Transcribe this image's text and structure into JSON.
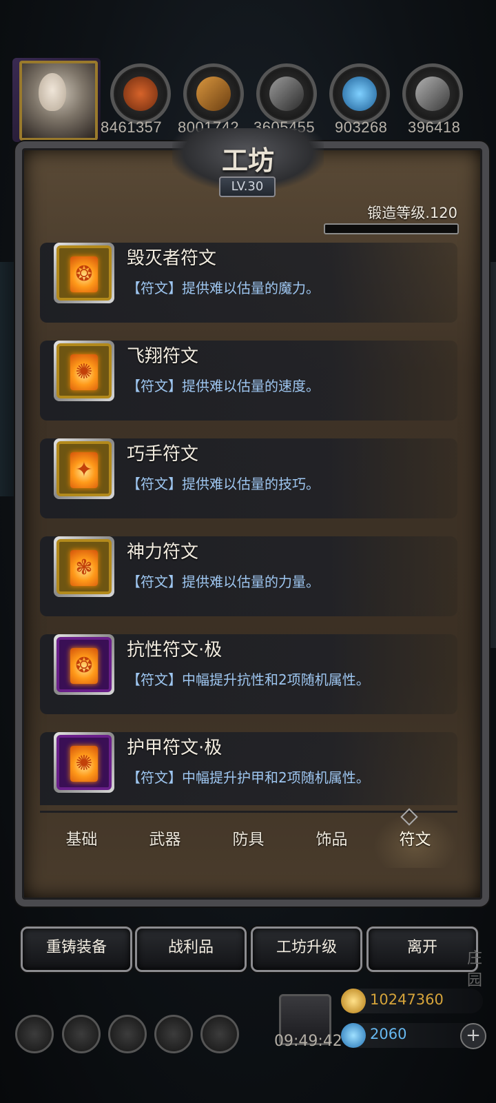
{
  "resources": [
    {
      "icon": "meat-icon",
      "value": "8461357",
      "color": "#a2481d"
    },
    {
      "icon": "wood-icon",
      "value": "8001742",
      "color": "#b9772d"
    },
    {
      "icon": "iron-icon",
      "value": "3605455",
      "color": "#5a5a5a"
    },
    {
      "icon": "crystal-icon",
      "value": "903268",
      "color": "#2e8fd8"
    },
    {
      "icon": "ingot-icon",
      "value": "396418",
      "color": "#7a7a7a"
    }
  ],
  "panel": {
    "title": "工坊",
    "level": "LV.30",
    "forge_level": "锻造等级.120",
    "forge_progress": 0
  },
  "runes": [
    {
      "name": "毁灭者符文",
      "desc": "【符文】提供难以估量的魔力。",
      "rarity": "gold",
      "glyph": "❂"
    },
    {
      "name": "飞翔符文",
      "desc": "【符文】提供难以估量的速度。",
      "rarity": "gold",
      "glyph": "✺"
    },
    {
      "name": "巧手符文",
      "desc": "【符文】提供难以估量的技巧。",
      "rarity": "gold",
      "glyph": "✦"
    },
    {
      "name": "神力符文",
      "desc": "【符文】提供难以估量的力量。",
      "rarity": "gold",
      "glyph": "❃"
    },
    {
      "name": "抗性符文·极",
      "desc": "【符文】中幅提升抗性和2项随机属性。",
      "rarity": "purple",
      "glyph": "❂"
    },
    {
      "name": "护甲符文·极",
      "desc": "【符文】中幅提升护甲和2项随机属性。",
      "rarity": "purple",
      "glyph": "✺"
    }
  ],
  "tabs": [
    "基础",
    "武器",
    "防具",
    "饰品",
    "符文"
  ],
  "active_tab": "符文",
  "actions": [
    "重铸装备",
    "战利品",
    "工坊升级",
    "离开"
  ],
  "hud": {
    "time": "09:49:42",
    "gold": "10247360",
    "gems": "2060",
    "plus": "+",
    "edge_text": "庄园"
  }
}
